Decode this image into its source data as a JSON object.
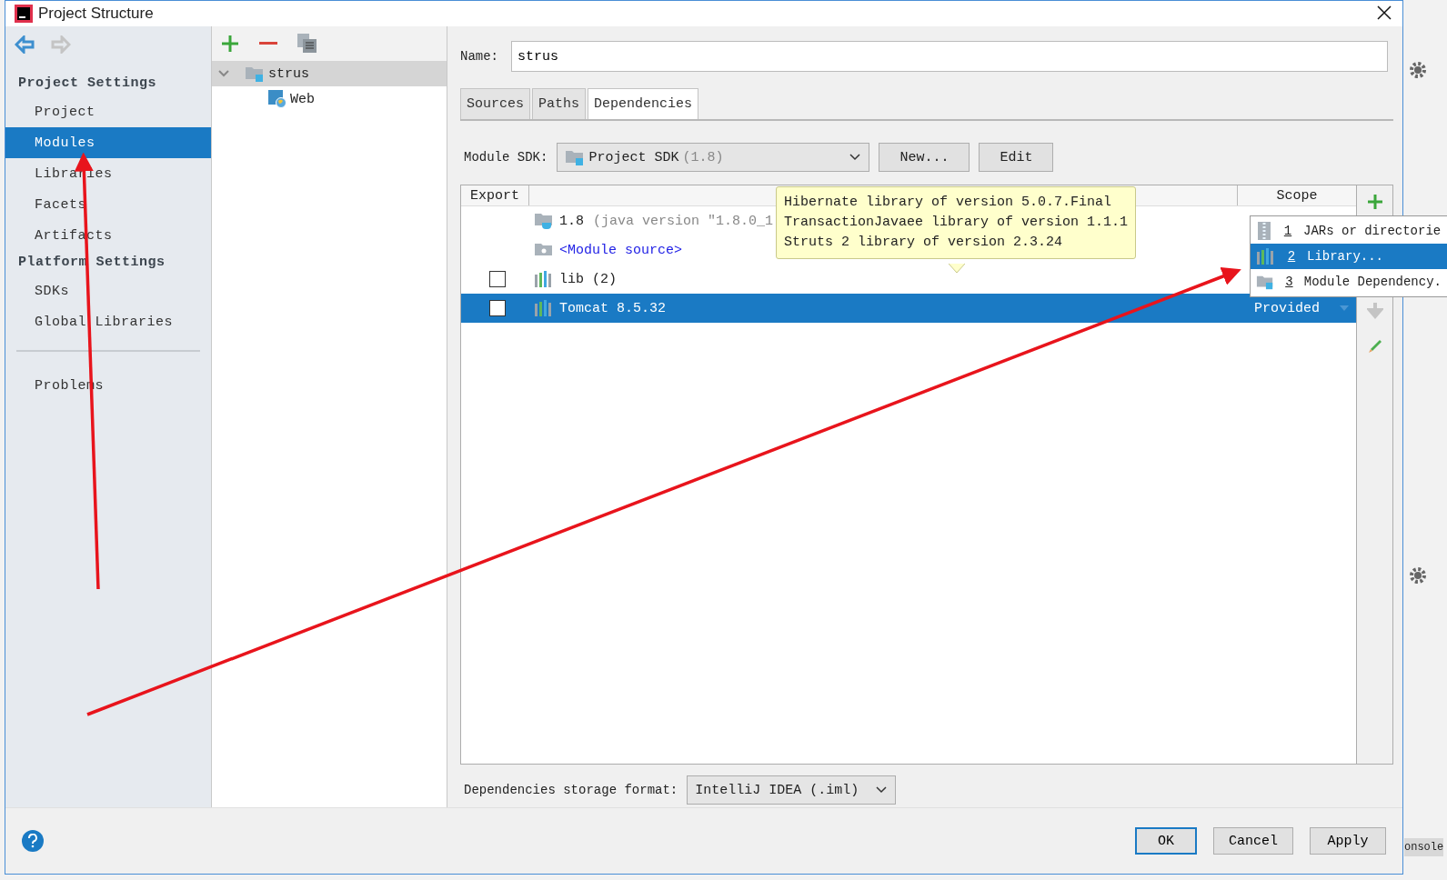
{
  "window": {
    "title": "Project Structure"
  },
  "nav": {
    "back_enabled": true,
    "forward_enabled": false
  },
  "sidebar": {
    "groups": [
      {
        "title": "Project Settings",
        "items": [
          {
            "label": "Project",
            "selected": false
          },
          {
            "label": "Modules",
            "selected": true
          },
          {
            "label": "Libraries",
            "selected": false
          },
          {
            "label": "Facets",
            "selected": false
          },
          {
            "label": "Artifacts",
            "selected": false
          }
        ]
      },
      {
        "title": "Platform Settings",
        "items": [
          {
            "label": "SDKs",
            "selected": false
          },
          {
            "label": "Global Libraries",
            "selected": false
          }
        ]
      },
      {
        "items": [
          {
            "label": "Problems",
            "selected": false
          }
        ]
      }
    ]
  },
  "module_tree": [
    {
      "label": "strus",
      "kind": "module",
      "expanded": true,
      "selected": true,
      "children": [
        {
          "label": "Web",
          "kind": "web",
          "selected": false
        }
      ]
    }
  ],
  "name_field": {
    "label": "Name:",
    "value": "strus"
  },
  "tabs": [
    {
      "label": "Sources",
      "selected": false
    },
    {
      "label": "Paths",
      "selected": false
    },
    {
      "label": "Dependencies",
      "selected": true
    }
  ],
  "module_sdk": {
    "label": "Module SDK:",
    "value": "Project SDK",
    "version": "(1.8)",
    "buttons": [
      "New...",
      "Edit"
    ]
  },
  "dependencies": {
    "columns": [
      "Export",
      "Scope"
    ],
    "rows": [
      {
        "kind": "sdk",
        "label": "1.8",
        "detail": "(java version \"1.8.0_1",
        "selected": false
      },
      {
        "kind": "source",
        "label": "<Module source>",
        "selected": false
      },
      {
        "kind": "library",
        "label": "lib (2)",
        "checked": false,
        "selected": false
      },
      {
        "kind": "library",
        "label": "Tomcat 8.5.32",
        "checked": false,
        "scope": "Provided",
        "selected": true
      }
    ],
    "side_tools": [
      {
        "kind": "add",
        "disabled": false
      },
      {
        "kind": "down",
        "disabled": true
      },
      {
        "kind": "edit",
        "disabled": false
      }
    ]
  },
  "tooltip": {
    "lines": [
      "Hibernate library of version 5.0.7.Final",
      "TransactionJavaee library of version 1.1.1",
      "Struts 2 library of version 2.3.24"
    ]
  },
  "popup_menu": {
    "items": [
      {
        "kind": "jars",
        "number": "1",
        "label": "JARs or directorie",
        "selected": false
      },
      {
        "kind": "library",
        "number": "2",
        "label": "Library...",
        "selected": true
      },
      {
        "kind": "module",
        "number": "3",
        "label": "Module Dependency.",
        "selected": false
      }
    ]
  },
  "storage_format": {
    "label": "Dependencies storage format:",
    "value": "IntelliJ IDEA (.iml)"
  },
  "buttons": [
    {
      "label": "OK",
      "default": true
    },
    {
      "label": "Cancel",
      "default": false
    },
    {
      "label": "Apply",
      "default": false
    }
  ],
  "background": {
    "tab": "onsole"
  }
}
